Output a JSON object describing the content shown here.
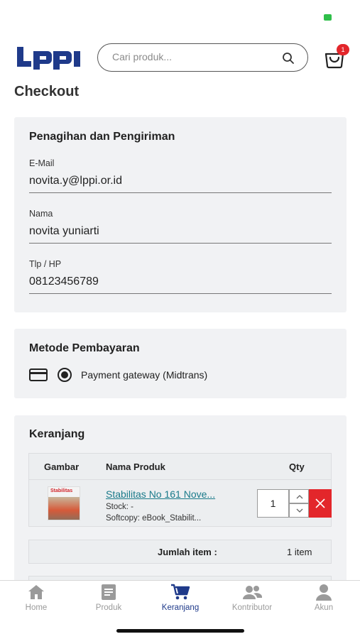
{
  "header": {
    "logo_text": "LPPI",
    "search_placeholder": "Cari produk...",
    "cart_badge": "1"
  },
  "page_title": "Checkout",
  "billing": {
    "title": "Penagihan dan Pengiriman",
    "email_label": "E-Mail",
    "email_value": "novita.y@lppi.or.id",
    "name_label": "Nama",
    "name_value": "novita yuniarti",
    "phone_label": "Tlp / HP",
    "phone_value": "08123456789"
  },
  "payment": {
    "title": "Metode Pembayaran",
    "option_label": "Payment gateway (Midtrans)"
  },
  "cart": {
    "title": "Keranjang",
    "columns": [
      "Gambar",
      "Nama Produk",
      "Qty"
    ],
    "item": {
      "thumb_title": "Stabilitas",
      "name": "Stabilitas No 161 Nove...",
      "stock": "Stock: -",
      "softcopy": "Softcopy: eBook_Stabilit...",
      "qty": "1"
    },
    "summary_label": "Jumlah item :",
    "summary_value": "1 item"
  },
  "nav": {
    "items": [
      {
        "label": "Home"
      },
      {
        "label": "Produk"
      },
      {
        "label": "Keranjang"
      },
      {
        "label": "Kontributor"
      },
      {
        "label": "Akun"
      }
    ]
  },
  "colors": {
    "brand": "#1f3a8a",
    "danger": "#e3262b",
    "link": "#1a7a8a",
    "card_bg": "#f1f2f4"
  }
}
